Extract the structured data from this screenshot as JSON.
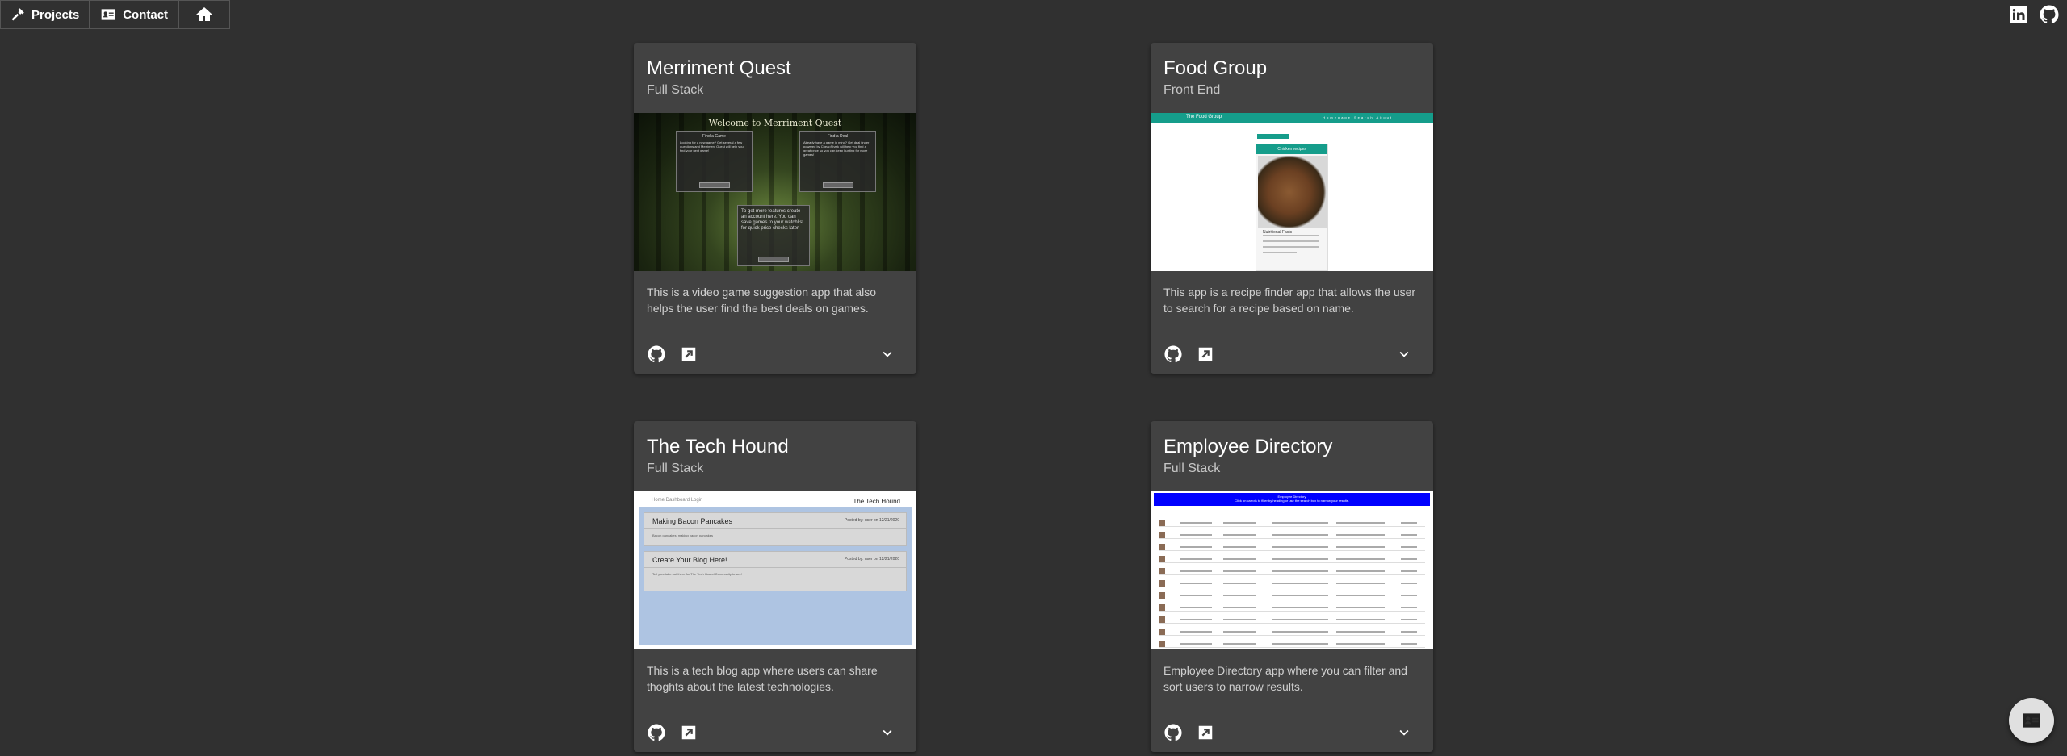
{
  "nav": {
    "projects_label": "Projects",
    "contact_label": "Contact",
    "home_icon": "home-icon",
    "projects_icon": "hammer-icon",
    "contact_icon": "contact-card-icon"
  },
  "social": {
    "linkedin_icon": "linkedin-icon",
    "github_icon": "github-icon"
  },
  "cards": [
    {
      "title": "Merriment Quest",
      "subheader": "Full Stack",
      "description": "This is a video game suggestion app that also helps the user find the best deals on games.",
      "screenshot": {
        "heading": "Welcome to Merriment Quest",
        "box1_title": "Find a Game",
        "box1_text": "Looking for a new game? Get several a few questions and Merriment Quest will help you find your next game!",
        "box1_button": "Discover Games",
        "box2_title": "Find a Deal",
        "box2_text": "Already have a game in mind? Get deal finder powered by CheapShark will help you find a great price so you can keep hunting for more games!",
        "box2_button": "Discover Deals",
        "box3_text": "To get more features create an account here. You can save games to your watchlist for quick price checks later.",
        "box3_button": "Create Account"
      }
    },
    {
      "title": "Food Group",
      "subheader": "Front End",
      "description": "This app is a recipe finder app that allows the user to search for a recipe based on name.",
      "screenshot": {
        "brand": "The Food Group",
        "links": "Homepage  Search  About",
        "panel_title": "Chicken recipes",
        "section_label": "Nutritional Facts"
      }
    },
    {
      "title": "The Tech Hound",
      "subheader": "Full Stack",
      "description": "This is a tech blog app where users can share thoghts about the latest technologies.",
      "screenshot": {
        "links": "Home  Dashboard  Login",
        "brand": "The Tech Hound",
        "post1_title": "Making Bacon Pancakes",
        "post1_meta": "Posted by: user on 12/21/2020",
        "post1_body": "Bacon pancakes, making bacon pancakes",
        "post2_title": "Create Your Blog Here!",
        "post2_meta": "Posted by: user on 12/21/2020",
        "post2_body": "Tell your take out there for The Tech Hound Community to see!"
      }
    },
    {
      "title": "Employee Directory",
      "subheader": "Full Stack",
      "description": "Employee Directory app where you can filter and sort users to narrow results.",
      "screenshot": {
        "header": "Employee Directory",
        "subheader": "Click on carrots to filter by heading or use the search box to narrow your results."
      }
    }
  ],
  "card_actions": {
    "github_icon": "github-icon",
    "external_link_icon": "open-in-new-icon",
    "expand_icon": "chevron-down-icon"
  },
  "fab": {
    "icon": "contact-card-icon"
  }
}
